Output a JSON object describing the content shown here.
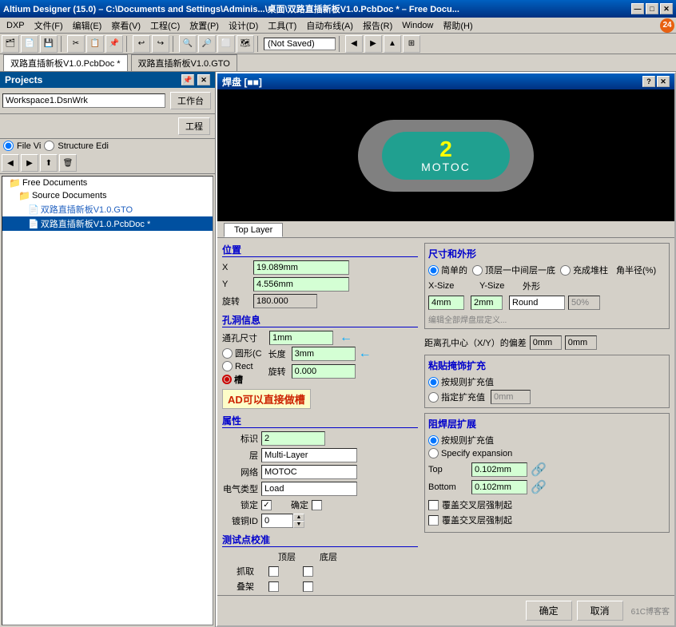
{
  "titleBar": {
    "text": "Altium Designer (15.0) – C:\\Documents and Settings\\Adminis...\\桌面\\双路直插新板V1.0.PcbDoc * – Free Docu...",
    "btnMin": "—",
    "btnMax": "□",
    "btnClose": "✕"
  },
  "menuBar": {
    "items": [
      "DXP",
      "文件(F)",
      "编辑(E)",
      "察看(V)",
      "工程(C)",
      "放置(P)",
      "设计(D)",
      "工具(T)",
      "自动布线(A)",
      "报告(R)",
      "Window",
      "帮助(H)"
    ]
  },
  "toolbar": {
    "notSaved": "(Not Saved)"
  },
  "tabBar": {
    "tabs": [
      "双路直插新板V1.0.PcbDoc *",
      "双路直插新板V1.0.GTO"
    ]
  },
  "sidebar": {
    "title": "Projects",
    "workspace": "Workspace1.DsnWrk",
    "btnWorkspace": "工作台",
    "btnProject": "工程",
    "radioFile": "File Vi",
    "radioStructure": "Structure Edi",
    "tree": [
      {
        "label": "Free Documents",
        "level": 0,
        "type": "folder"
      },
      {
        "label": "Source Documents",
        "level": 1,
        "type": "folder"
      },
      {
        "label": "双路直插新板V1.0.GTO",
        "level": 2,
        "type": "file"
      },
      {
        "label": "双路直插新板V1.0.PcbDoc *",
        "level": 2,
        "type": "file",
        "selected": true
      }
    ]
  },
  "dialog": {
    "title": "焊盘 [■■]",
    "btnHelp": "?",
    "btnClose": "✕",
    "preview": {
      "padNumber": "2",
      "padLabel": "MOTOC"
    },
    "layerTab": "Top Layer",
    "position": {
      "sectionTitle": "位置",
      "xLabel": "X",
      "xValue": "19.089mm",
      "yLabel": "Y",
      "yValue": "4.556mm",
      "rotLabel": "旋转",
      "rotValue": "180.000"
    },
    "hole": {
      "sectionTitle": "孔洞信息",
      "sizeLabel": "通孔尺寸",
      "sizeValue": "1mm",
      "roundLabel": "圆形(C",
      "rectLabel": "Rect",
      "slotLabel": "槽",
      "lengthLabel": "长度",
      "lengthValue": "3mm",
      "rotLabel": "旋转",
      "rotValue": "0.000"
    },
    "properties": {
      "sectionTitle": "属性",
      "标识Label": "标识",
      "标识Value": "2",
      "层Label": "层",
      "层Value": "Multi-Layer",
      "网络Label": "网络",
      "网络Value": "MOTOC",
      "电气类型Label": "电气类型",
      "电气类型Value": "Load",
      "锁定Label": "锁定",
      "确定Label": "确定",
      "镀铜IDLabel": "镀铜ID",
      "镀铜IDValue": "0"
    },
    "testPoint": {
      "sectionTitle": "测试点校准",
      "顶层Label": "顶层",
      "底层Label": "底层",
      "抓取Label": "抓取",
      "叠架Label": "叠架"
    },
    "rightPanel": {
      "sizeShape": {
        "sectionTitle": "尺寸和外形",
        "simple": "简单的",
        "topMiddleBottom": "顶层一中间层一底",
        "fullStack": "充成堆柱",
        "angleLabel": "角半径(%)",
        "xSizeLabel": "X-Size",
        "ySizeLabel": "Y-Size",
        "shapeLabel": "外形",
        "xSizeValue": "4mm",
        "ySizeValue": "2mm",
        "shapeValue": "Round",
        "angleValue": "50%",
        "editLink": "编辑全部焊盘层定义..."
      },
      "holeOffset": {
        "sectionTitle": "距离孔中心（X/Y）的偏差",
        "xValue": "0mm",
        "yValue": "0mm"
      },
      "pasteMask": {
        "sectionTitle": "粘贴掩饰扩充",
        "byRule": "按规则扩充值",
        "specify": "指定扩充值",
        "specifyValue": "0mm"
      },
      "solderMask": {
        "sectionTitle": "阻焊层扩展",
        "byRule": "按规则扩充值",
        "specify": "Specify expansion",
        "topLabel": "Top",
        "topValue": "0.102mm",
        "bottomLabel": "Bottom",
        "bottomValue": "0.102mm",
        "check1": "覆盖交叉层强制起",
        "check2": "覆盖交叉层强制起"
      }
    },
    "footer": {
      "ok": "确定",
      "cancel": "取消",
      "brand": "61C博客客"
    },
    "callout": "AD可以直接做槽"
  }
}
